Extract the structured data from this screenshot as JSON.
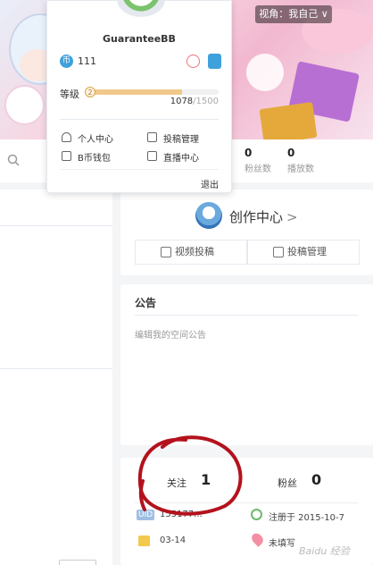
{
  "header": {
    "view_toggle": "视角：我自己 ∨"
  },
  "stats": {
    "fans_count": "0",
    "fans_label": "粉丝数",
    "plays_count": "0",
    "plays_label": "播放数"
  },
  "popup": {
    "username": "GuaranteeBB",
    "coin_icon_text": "币",
    "coins": "111",
    "level_label": "等级",
    "level_badge": "2",
    "level_current": "1078",
    "level_max": "/1500",
    "level_fraction": 0.7187,
    "menu": {
      "personal_center": "个人中心",
      "upload_manage": "投稿管理",
      "wallet": "B币钱包",
      "live_center": "直播中心"
    },
    "logout": "退出"
  },
  "creator": {
    "title": "创作中心",
    "chevron": ">",
    "video_upload": "视频投稿",
    "manage_upload": "投稿管理"
  },
  "notice": {
    "title": "公告",
    "placeholder": "编辑我的空间公告"
  },
  "profile": {
    "follow_label": "关注",
    "follow_count": "1",
    "fans_label": "粉丝",
    "fans_count": "0",
    "uid_badge": "UID",
    "uid_value": "155177...",
    "registered": "注册于 2015-10-7",
    "birthday": "03-14",
    "location": "未填写",
    "watermark": "Baidu 经验"
  },
  "colors": {
    "accent_blue": "#3fa1db",
    "level_bar": "#f0c98a",
    "scribble_red": "#b3121c"
  }
}
